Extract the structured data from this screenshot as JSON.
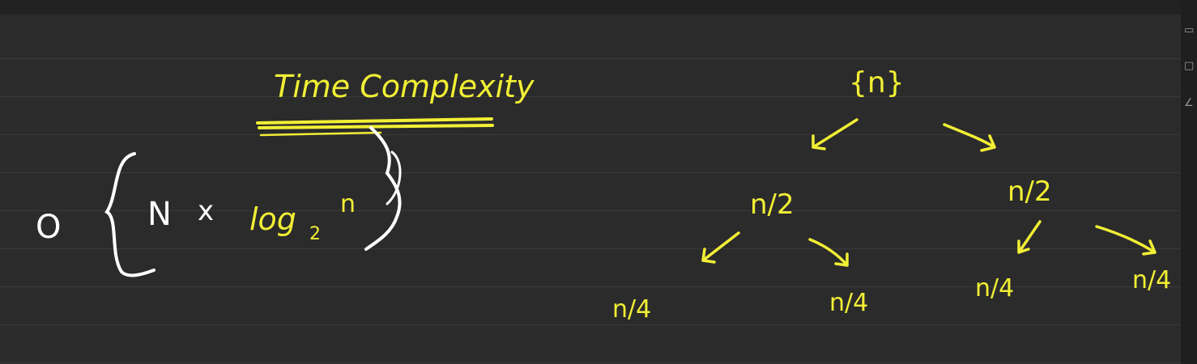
{
  "whiteboard": {
    "heading": "Time Complexity",
    "formula": {
      "big_o": "O",
      "n": "N",
      "times": "x",
      "log": "log",
      "base": "2",
      "arg": "n"
    },
    "tree": {
      "root": "{n}",
      "level1_left": "n/2",
      "level1_right": "n/2",
      "level2": [
        "n/4",
        "n/4",
        "n/4",
        "n/4"
      ]
    },
    "colors": {
      "background": "#2b2b2b",
      "rule_lines": "#3a3a3a",
      "highlighter": "#f2ef35",
      "chalk": "#ffffff"
    }
  },
  "toolbar": {
    "icons": [
      "eraser-icon",
      "shape-icon",
      "pen-icon"
    ]
  }
}
